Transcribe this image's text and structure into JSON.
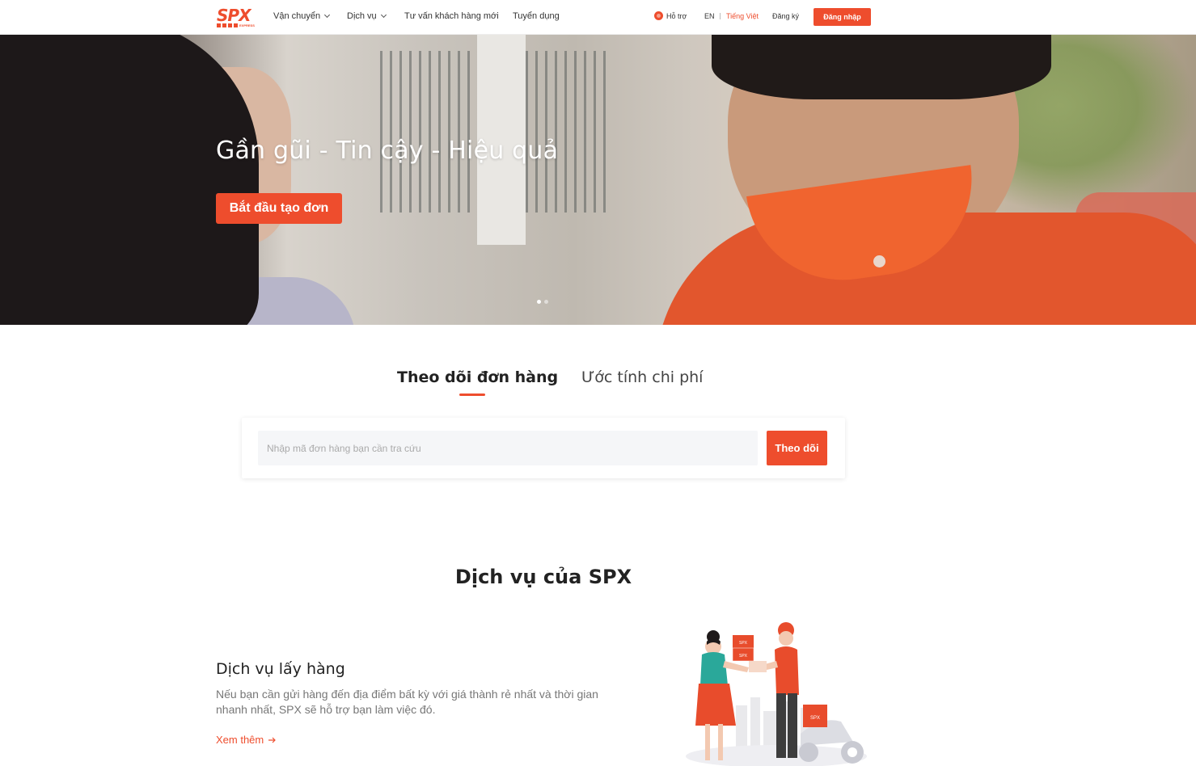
{
  "header": {
    "logo_text": "SPX",
    "logo_sub": "EXPRESS",
    "nav": [
      "Vận chuyển",
      "Dịch vụ",
      "Tư vấn khách hàng mới",
      "Tuyển dụng"
    ],
    "support_label": "Hỗ trợ",
    "lang_en": "EN",
    "lang_vi": "Tiếng Việt",
    "register_label": "Đăng ký",
    "login_label": "Đăng nhập"
  },
  "hero": {
    "title": "Gần gũi - Tin cậy - Hiệu quả",
    "cta_label": "Bắt đầu tạo đơn",
    "slide_count": 2,
    "active_slide": 1
  },
  "tracking": {
    "tabs": [
      "Theo dõi đơn hàng",
      "Ước tính chi phí"
    ],
    "active_tab": 0,
    "input_placeholder": "Nhập mã đơn hàng bạn cần tra cứu",
    "input_value": "",
    "button_label": "Theo dõi"
  },
  "services": {
    "section_title": "Dịch vụ của SPX",
    "item": {
      "title": "Dịch vụ lấy hàng",
      "description": "Nếu bạn cần gửi hàng đến địa điểm bất kỳ với giá thành rẻ nhất và thời gian nhanh nhất, SPX sẽ hỗ trợ bạn làm việc đó.",
      "link_label": "Xem thêm",
      "box_label": "SPX"
    }
  },
  "colors": {
    "brand": "#ee4d2d",
    "text_dark": "#222222",
    "text_muted": "#777777"
  }
}
